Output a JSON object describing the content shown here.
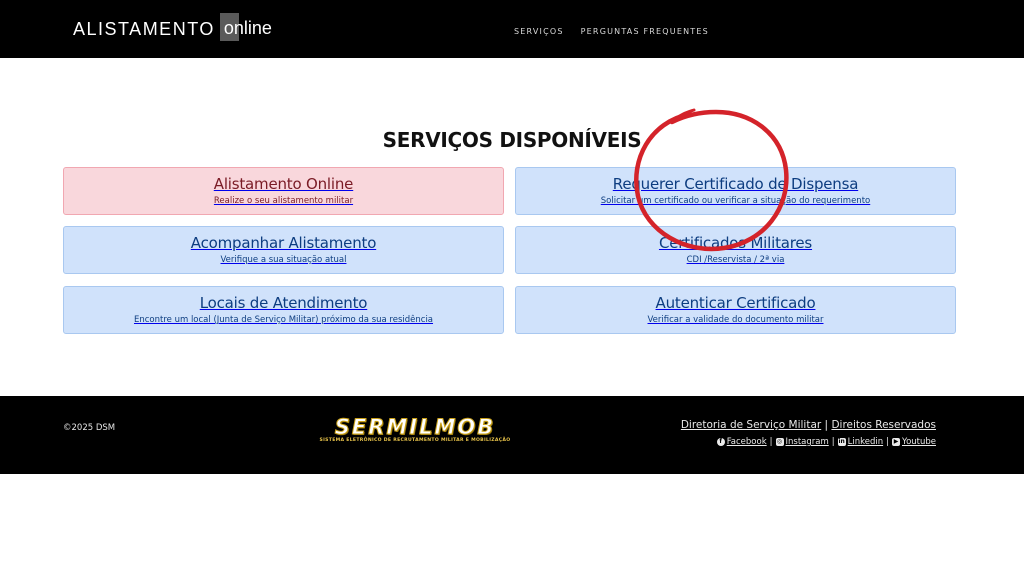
{
  "header": {
    "brand_main": "ALISTAMENTO",
    "brand_sub": "online",
    "nav": [
      {
        "label": "SERVIÇOS"
      },
      {
        "label": "PERGUNTAS FREQUENTES"
      }
    ]
  },
  "main": {
    "title": "SERVIÇOS DISPONÍVEIS",
    "cards": [
      {
        "title": "Alistamento Online",
        "subtitle": "Realize o seu alistamento militar"
      },
      {
        "title": "Requerer Certificado de Dispensa",
        "subtitle": "Solicitar um certificado ou verificar a situação do requerimento"
      },
      {
        "title": "Acompanhar Alistamento",
        "subtitle": "Verifique a sua situação atual"
      },
      {
        "title": "Certificados Militares",
        "subtitle": "CDI /Reservista / 2ª via"
      },
      {
        "title": "Locais de Atendimento",
        "subtitle": "Encontre um local (Junta de Serviço Militar) próximo da sua residência"
      },
      {
        "title": "Autenticar Certificado",
        "subtitle": "Verificar a validade do documento militar"
      }
    ]
  },
  "footer": {
    "copyright": "©2025 DSM",
    "logo_word": "SERMILMOB",
    "logo_sub": "SISTEMA ELETRÔNICO DE RECRUTAMENTO MILITAR E MOBILIZAÇÃO",
    "link_directory": "Diretoria de Serviço Militar",
    "separator": "|",
    "link_rights": "Direitos Reservados",
    "social": [
      {
        "label": "Facebook",
        "icon": "facebook-icon"
      },
      {
        "label": "Instagram",
        "icon": "instagram-icon"
      },
      {
        "label": "Linkedin",
        "icon": "linkedin-icon"
      },
      {
        "label": "Youtube",
        "icon": "youtube-icon"
      }
    ]
  },
  "colors": {
    "header_bg": "#000000",
    "card_blue": "#d0e2fb",
    "card_red": "#f9d7dc",
    "annotation_circle": "#d4232a"
  }
}
